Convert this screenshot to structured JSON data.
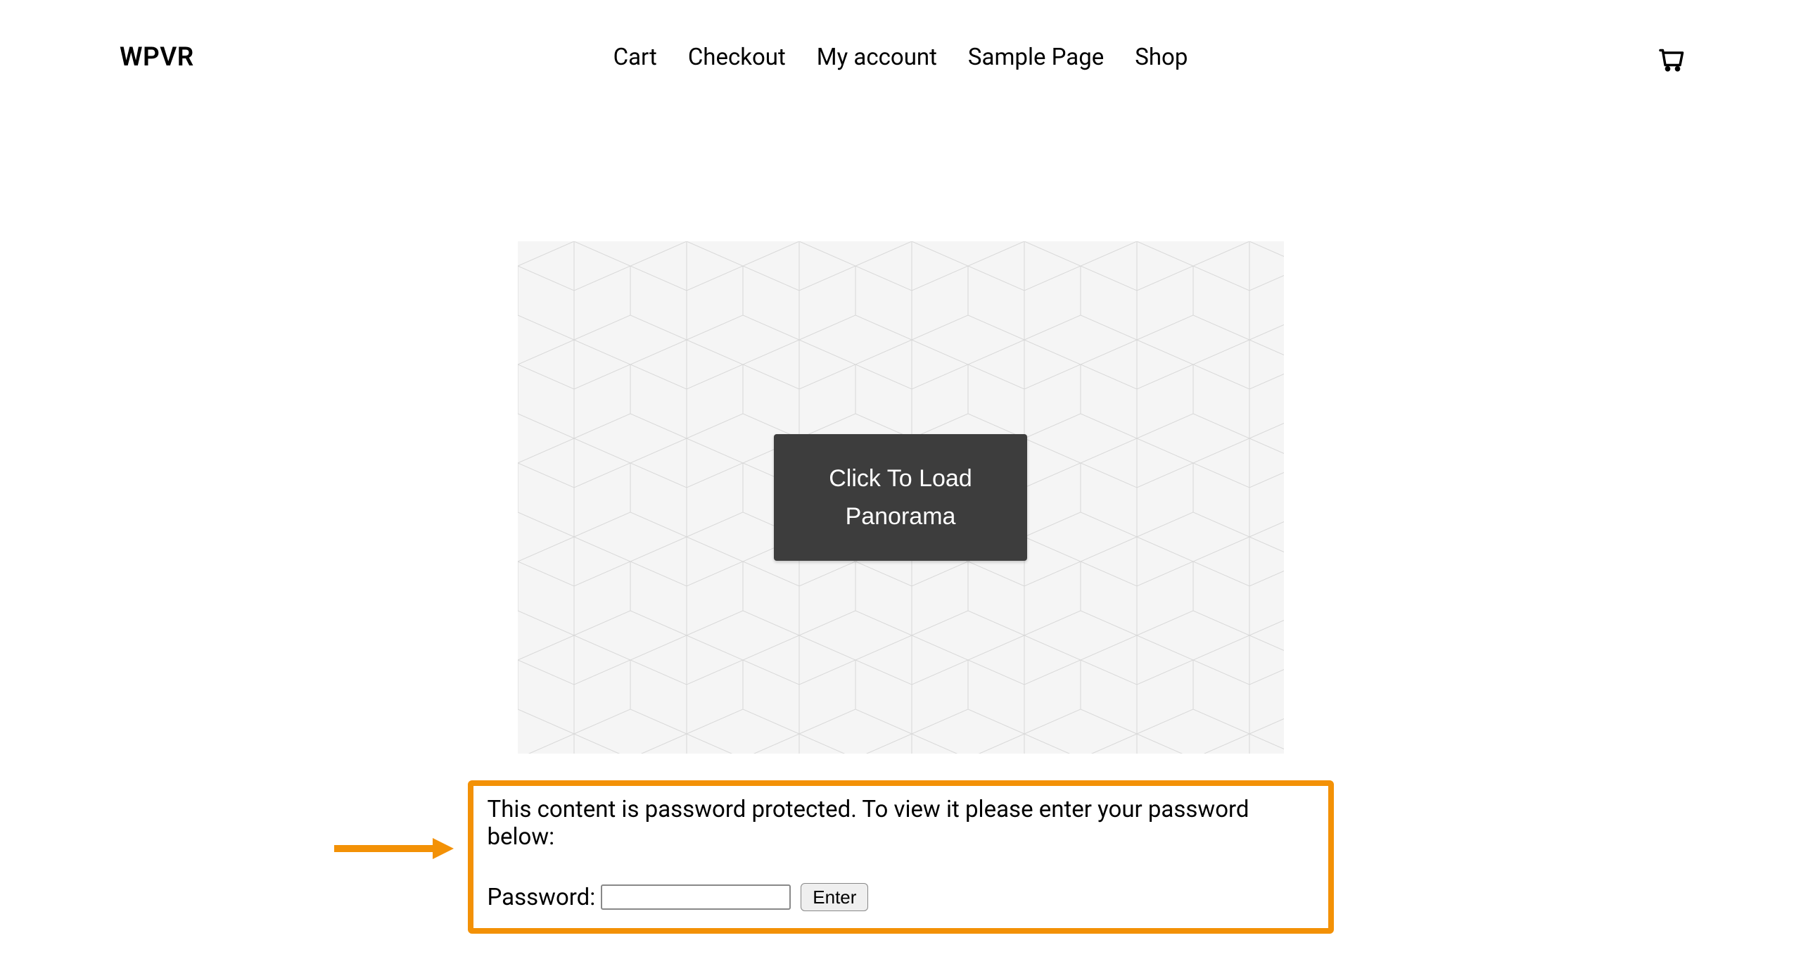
{
  "header": {
    "site_title": "WPVR",
    "nav": [
      {
        "label": "Cart"
      },
      {
        "label": "Checkout"
      },
      {
        "label": "My account"
      },
      {
        "label": "Sample Page"
      },
      {
        "label": "Shop"
      }
    ]
  },
  "panorama": {
    "load_button_label": "Click To Load Panorama"
  },
  "password_section": {
    "message": "This content is password protected. To view it please enter your password below:",
    "password_label": "Password:",
    "enter_button_label": "Enter"
  },
  "colors": {
    "highlight_border": "#f39106",
    "arrow": "#f39106",
    "load_button_bg": "#3d3d3d"
  }
}
